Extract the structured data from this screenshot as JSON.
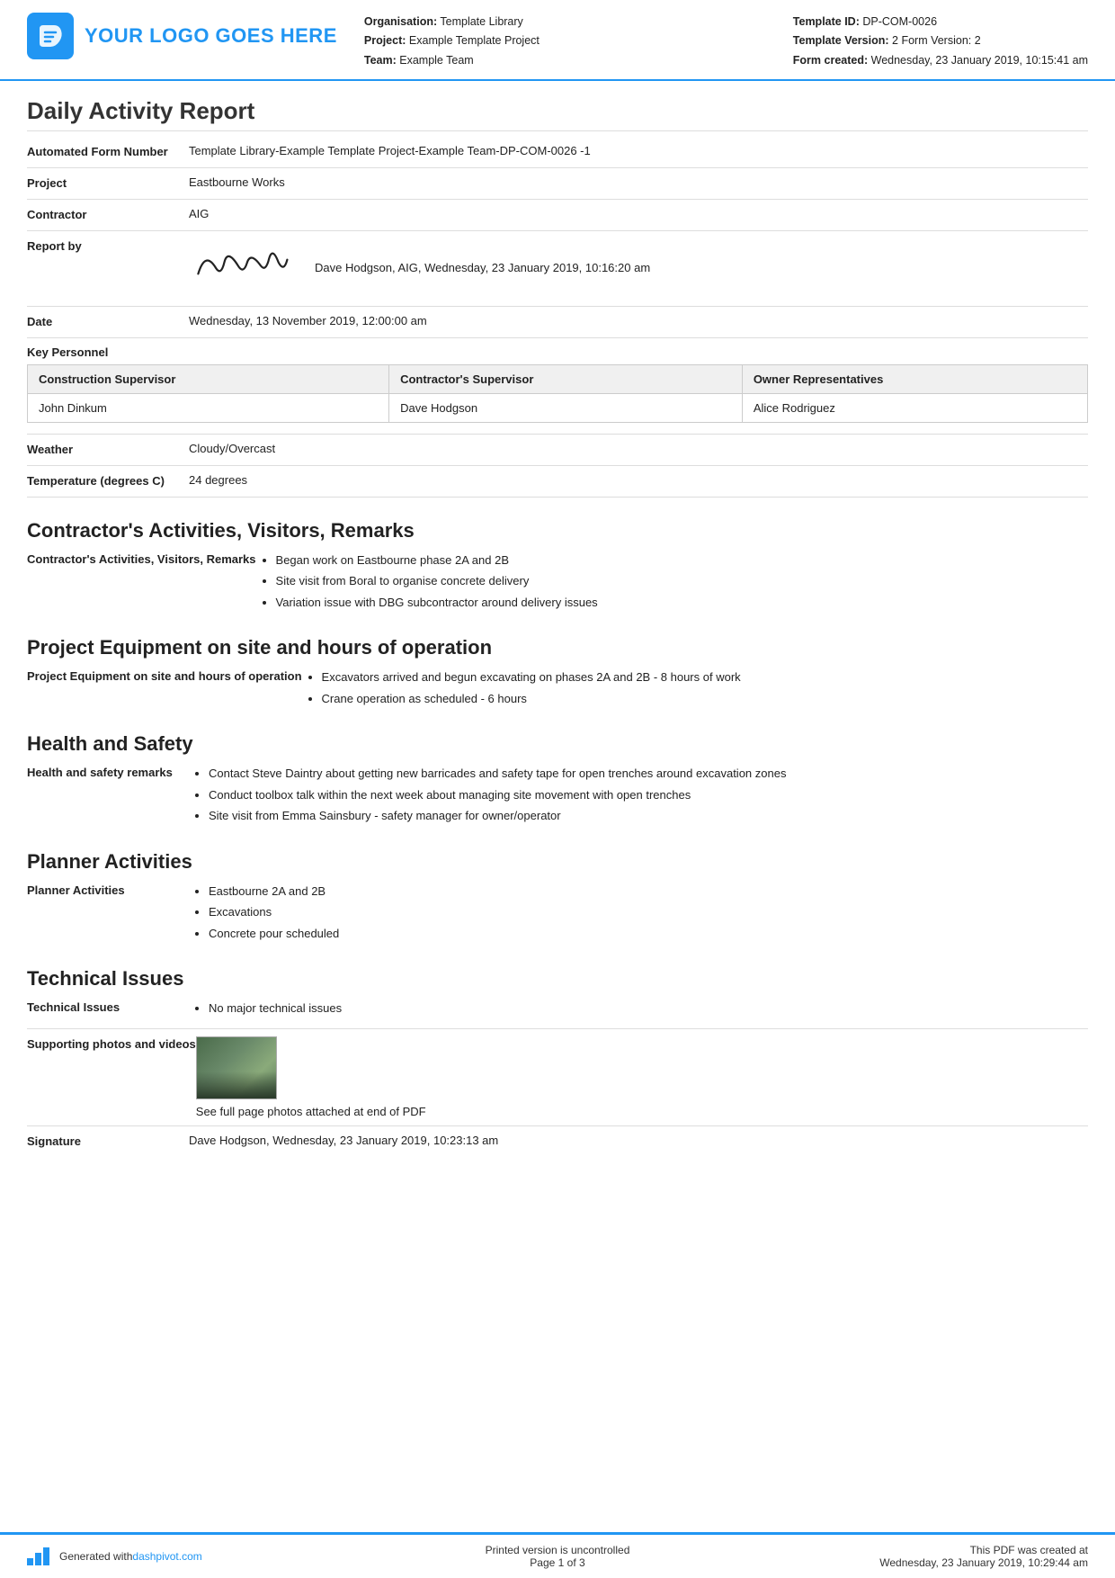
{
  "header": {
    "logo_text": "YOUR LOGO GOES HERE",
    "org_label": "Organisation:",
    "org_value": "Template Library",
    "project_label": "Project:",
    "project_value": "Example Template Project",
    "team_label": "Team:",
    "team_value": "Example Team",
    "template_id_label": "Template ID:",
    "template_id_value": "DP-COM-0026",
    "template_version_label": "Template Version:",
    "template_version_value": "2 Form Version: 2",
    "form_created_label": "Form created:",
    "form_created_value": "Wednesday, 23 January 2019, 10:15:41 am"
  },
  "report": {
    "title": "Daily Activity Report",
    "form_number_label": "Automated Form Number",
    "form_number_value": "Template Library-Example Template Project-Example Team-DP-COM-0026   -1",
    "project_label": "Project",
    "project_value": "Eastbourne Works",
    "contractor_label": "Contractor",
    "contractor_value": "AIG",
    "report_by_label": "Report by",
    "report_by_name": "Dave Hodgson, AIG, Wednesday, 23 January 2019, 10:16:20 am",
    "date_label": "Date",
    "date_value": "Wednesday, 13 November 2019, 12:00:00 am"
  },
  "key_personnel": {
    "label": "Key Personnel",
    "headers": [
      "Construction Supervisor",
      "Contractor's Supervisor",
      "Owner Representatives"
    ],
    "rows": [
      [
        "John Dinkum",
        "Dave Hodgson",
        "Alice Rodriguez"
      ]
    ]
  },
  "weather": {
    "label": "Weather",
    "value": "Cloudy/Overcast"
  },
  "temperature": {
    "label": "Temperature (degrees C)",
    "value": "24 degrees"
  },
  "sections": {
    "contractors": {
      "title": "Contractor's Activities, Visitors, Remarks",
      "field_label": "Contractor's Activities, Visitors, Remarks",
      "items": [
        "Began work on Eastbourne phase 2A and 2B",
        "Site visit from Boral to organise concrete delivery",
        "Variation issue with DBG subcontractor around delivery issues"
      ]
    },
    "equipment": {
      "title": "Project Equipment on site and hours of operation",
      "field_label": "Project Equipment on site and hours of operation",
      "items": [
        "Excavators arrived and begun excavating on phases 2A and 2B - 8 hours of work",
        "Crane operation as scheduled - 6 hours"
      ]
    },
    "health_safety": {
      "title": "Health and Safety",
      "field_label": "Health and safety remarks",
      "items": [
        "Contact Steve Daintry about getting new barricades and safety tape for open trenches around excavation zones",
        "Conduct toolbox talk within the next week about managing site movement with open trenches",
        "Site visit from Emma Sainsbury - safety manager for owner/operator"
      ]
    },
    "planner": {
      "title": "Planner Activities",
      "field_label": "Planner Activities",
      "items": [
        "Eastbourne 2A and 2B",
        "Excavations",
        "Concrete pour scheduled"
      ]
    },
    "technical": {
      "title": "Technical Issues",
      "field_label": "Technical Issues",
      "items": [
        "No major technical issues"
      ],
      "supporting_label": "Supporting photos and videos",
      "photo_caption": "See full page photos attached at end of PDF",
      "signature_label": "Signature",
      "signature_value": "Dave Hodgson, Wednesday, 23 January 2019, 10:23:13 am"
    }
  },
  "footer": {
    "generated_text": "Generated with ",
    "link_text": "dashpivot.com",
    "center_text": "Printed version is uncontrolled",
    "page_text": "Page 1 of 3",
    "right_text": "This PDF was created at",
    "right_date": "Wednesday, 23 January 2019, 10:29:44 am"
  }
}
